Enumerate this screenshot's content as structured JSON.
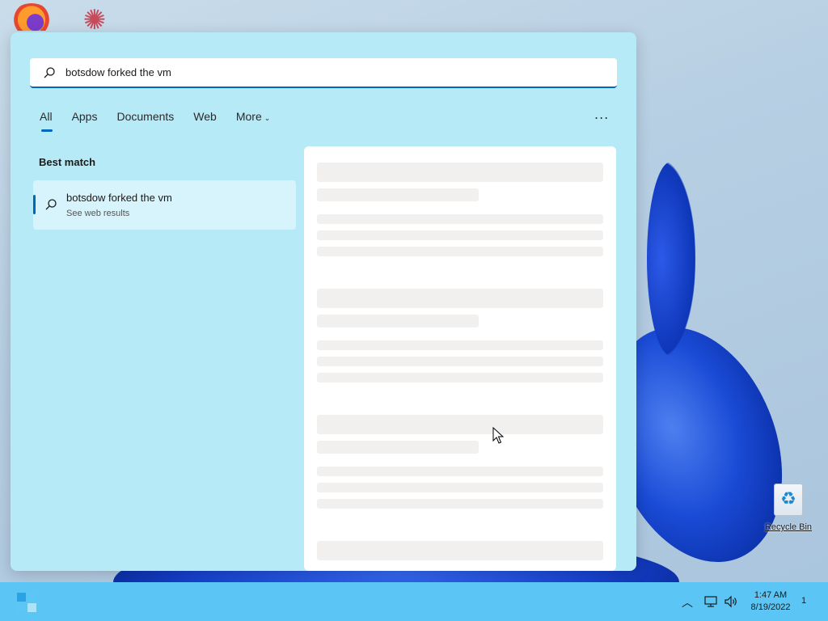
{
  "search": {
    "query": "botsdow forked the vm",
    "icon": "search-icon"
  },
  "tabs": [
    {
      "label": "All",
      "active": true
    },
    {
      "label": "Apps",
      "active": false
    },
    {
      "label": "Documents",
      "active": false
    },
    {
      "label": "Web",
      "active": false
    },
    {
      "label": "More",
      "active": false
    }
  ],
  "more_options_label": "...",
  "best_match": {
    "heading": "Best match",
    "result_title": "botsdow forked the vm",
    "result_subtitle": "See web results"
  },
  "desktop": {
    "recycle_bin_label": "Recycle Bin"
  },
  "taskbar": {
    "time": "1:47 AM",
    "date": "8/19/2022",
    "notification_count": "1"
  },
  "colors": {
    "panel_bg": "#b7eaf7",
    "accent": "#0067c0",
    "taskbar_bg": "#5bc6f5"
  }
}
